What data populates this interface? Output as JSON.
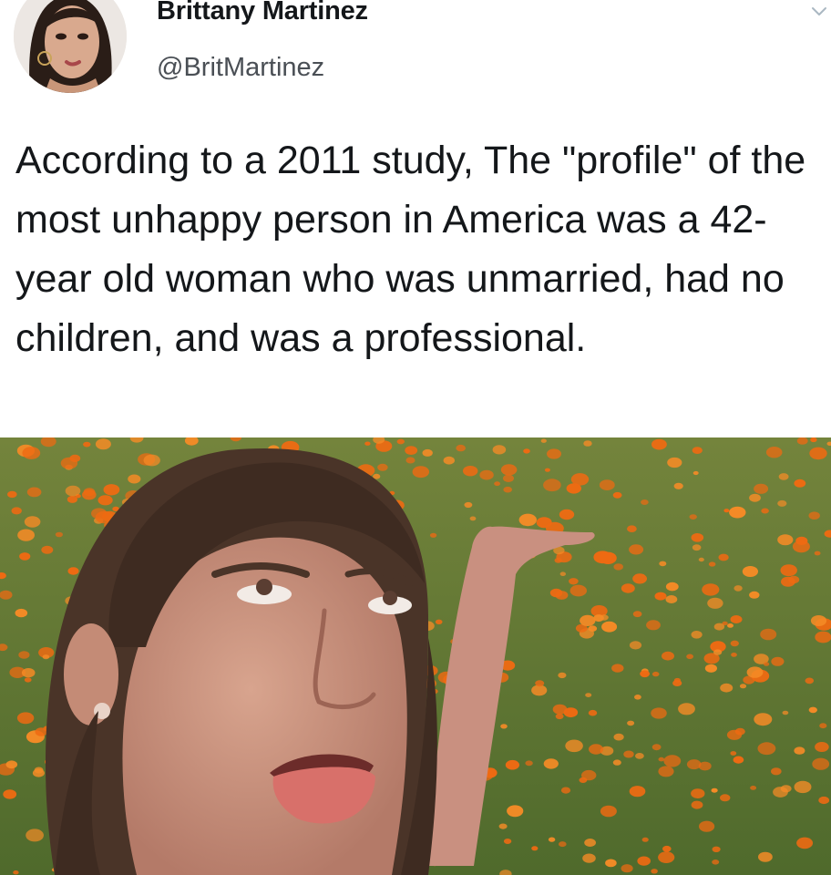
{
  "tweet": {
    "author_name": "Brittany Martinez",
    "author_handle": "@BritMartinez",
    "text": "According to a 2011 study, The \"profile\" of the most unhappy person in America was a 42-year old woman who was unmarried, had no children, and was a professional.",
    "menu_icon": "chevron-down-icon"
  },
  "colors": {
    "text": "#14171a",
    "handle": "#4a4f55",
    "poppy_orange": "#ee6a12",
    "foliage_green": "#5f7a34"
  }
}
